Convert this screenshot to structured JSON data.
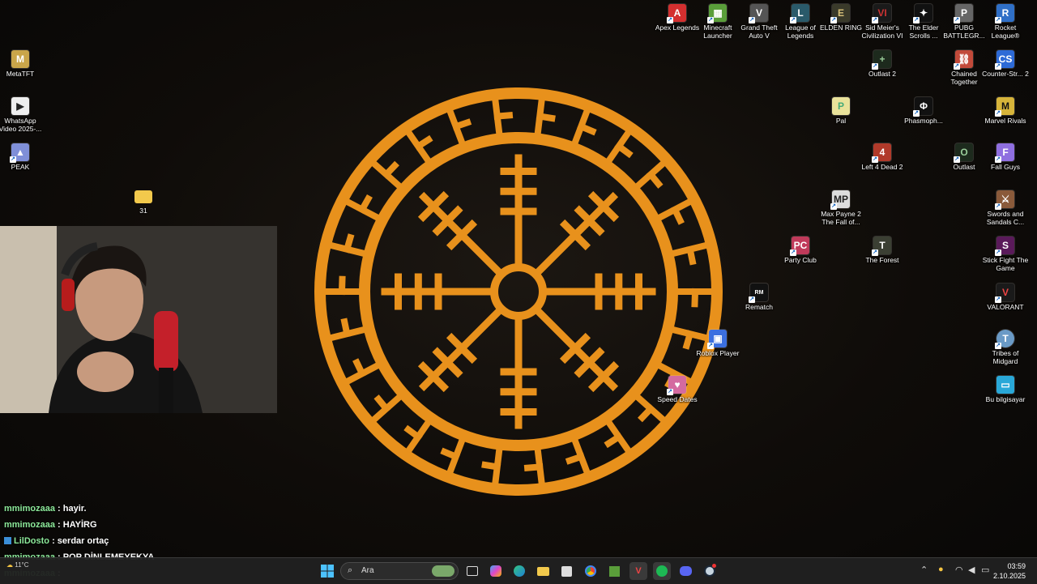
{
  "desktop_icons": {
    "apex": "Apex Legends",
    "minecraft": "Minecraft Launcher",
    "gta": "Grand Theft Auto V",
    "lol": "League of Legends",
    "elden": "ELDEN RING",
    "civ": "Sid Meier's Civilization VI",
    "elder": "The Elder Scrolls ...",
    "pubg": "PUBG BATTLEGR...",
    "rocket": "Rocket League®",
    "outlast2": "Outlast 2",
    "chained": "Chained Together",
    "cs2": "Counter-Str... 2",
    "pal": "Pal",
    "phasmo": "Phasmoph...",
    "marvel": "Marvel Rivals",
    "l4d2": "Left 4 Dead 2",
    "outlast": "Outlast",
    "fallguys": "Fall Guys",
    "maxpayne": "Max Payne 2 The Fall of...",
    "swords": "Swords and Sandals C...",
    "partyclub": "Party Club",
    "forest": "The Forest",
    "stickfight": "Stick Fight The Game",
    "rematch": "Rematch",
    "valorant": "VALORANT",
    "roblox": "Roblox Player",
    "tribes": "Tribes of Midgard",
    "speeddates": "Speed Dates",
    "thispc": "Bu bilgisayar",
    "metatft": "MetaTFT",
    "whatsapp": "WhatsApp Video 2025-...",
    "peak": "PEAK",
    "folder31": "31"
  },
  "chat": [
    {
      "user": "mmimozaaa",
      "msg": "hayir.",
      "badge": false
    },
    {
      "user": "mmimozaaa",
      "msg": "HAYİRG",
      "badge": false
    },
    {
      "user": "LilDosto",
      "msg": "serdar ortaç",
      "badge": true
    },
    {
      "user": "mmimozaaa",
      "msg": "POP DİNLEMEYEKYA",
      "badge": false
    },
    {
      "user": "mmimozaaa",
      "msg": "",
      "badge": false
    }
  ],
  "chat_sep": ":",
  "taskbar": {
    "search_placeholder": "Ara",
    "time": "03:59",
    "date": "2.10.2025",
    "weather": "11°C"
  },
  "colors": {
    "emblem": "#e8911c",
    "chat_user": "#8ce99a",
    "taskbar": "#202020"
  }
}
